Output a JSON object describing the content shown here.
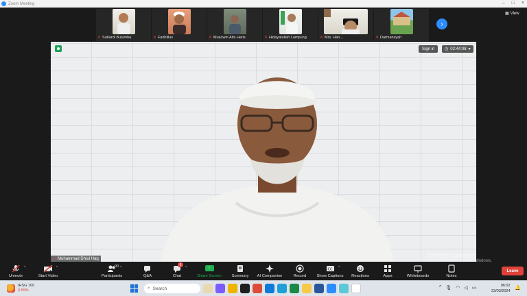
{
  "window": {
    "title": "Zoom Meeting"
  },
  "gallery": {
    "participants": [
      {
        "name": "Suhardi Bulumba"
      },
      {
        "name": "Fadhillus"
      },
      {
        "name": "Muazwin Alfa Haris"
      },
      {
        "name": "Hidayatullah Lampung"
      },
      {
        "name": "Mrs. Han..."
      },
      {
        "name": "Darmansyah"
      }
    ],
    "view_label": "View"
  },
  "main_video": {
    "speaker_name": "Muhammad Dhiul Haq",
    "sign_in_label": "Sign in",
    "timer": "02:44:08"
  },
  "toolbar": {
    "unmute": "Unmute",
    "start_video": "Start Video",
    "participants": "Participants",
    "participants_count": "90",
    "qa": "Q&A",
    "chat": "Chat",
    "chat_badge": "8",
    "share_screen": "Share Screen",
    "summary": "Summary",
    "ai_companion": "AI Companion",
    "record": "Record",
    "show_captions": "Show Captions",
    "reactions": "Reactions",
    "apps": "Apps",
    "whiteboards": "Whiteboards",
    "notes": "Notes",
    "leave": "Leave"
  },
  "watermark": {
    "line1": "Activate Windows",
    "line2": "Go to Settings to activate Windows."
  },
  "taskbar": {
    "weather_title": "IHSG 100",
    "weather_value": "0.59%",
    "search_placeholder": "Search",
    "time": "06:02",
    "date": "23/03/2024"
  },
  "colors": {
    "accent": "#2d8cff",
    "leave": "#e0433a",
    "share": "#1fb04f"
  }
}
